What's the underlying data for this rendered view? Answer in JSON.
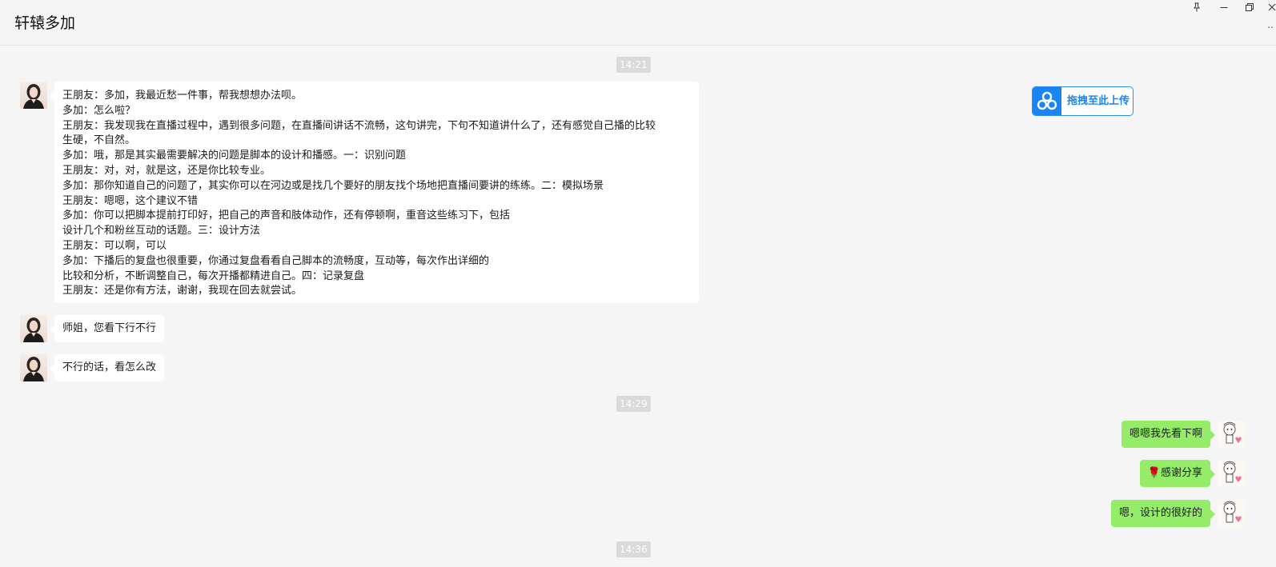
{
  "window": {
    "title": "轩辕多加",
    "controls": {
      "pin_icon": "pin-icon",
      "minimize_icon": "minimize-icon",
      "maximize_icon": "restore-icon",
      "close_icon": "close-icon",
      "more_icon": "more-icon"
    }
  },
  "upload": {
    "label": "拖拽至此上传",
    "icon": "baidu-netdisk-icon",
    "accent": "#1a84f3"
  },
  "timestamps": [
    "14:21",
    "14:29",
    "14:36"
  ],
  "messages": {
    "long_message_lines": [
      "王朋友：多加，我最近愁一件事，帮我想想办法呗。",
      "多加：怎么啦？",
      "王朋友：我发现我在直播过程中，遇到很多问题，在直播间讲话不流畅，这句讲完，下句不知道讲什么了，还有感觉自己播的比较",
      "生硬，不自然。",
      "多加：哦，那是其实最需要解决的问题是脚本的设计和播感。一：识别问题",
      "王朋友：对，对，就是这，还是你比较专业。",
      "多加：那你知道自己的问题了，其实你可以在河边或是找几个要好的朋友找个场地把直播间要讲的练练。二：模拟场景",
      "王朋友：嗯嗯，这个建议不错",
      "多加：你可以把脚本提前打印好，把自己的声音和肢体动作，还有停顿啊，重音这些练习下，包括",
      "设计几个和粉丝互动的话题。三：设计方法",
      "王朋友：可以啊，可以",
      "多加：下播后的复盘也很重要，你通过复盘看看自己脚本的流畅度，互动等，每次作出详细的",
      "比较和分析，不断调整自己，每次开播都精进自己。四：记录复盘",
      "王朋友：还是你有方法，谢谢，我现在回去就尝试。"
    ],
    "incoming_short": [
      "师姐，您看下行不行",
      "不行的话，看怎么改"
    ],
    "outgoing": {
      "msg1": "嗯嗯我先看下啊",
      "msg2_emoji": "rose-emoji",
      "msg2_text": "感谢分享",
      "msg3": "嗯，设计的很好的"
    }
  },
  "colors": {
    "outgoing_bubble": "#95ec69",
    "incoming_bubble": "#ffffff",
    "background": "#f5f5f5"
  }
}
